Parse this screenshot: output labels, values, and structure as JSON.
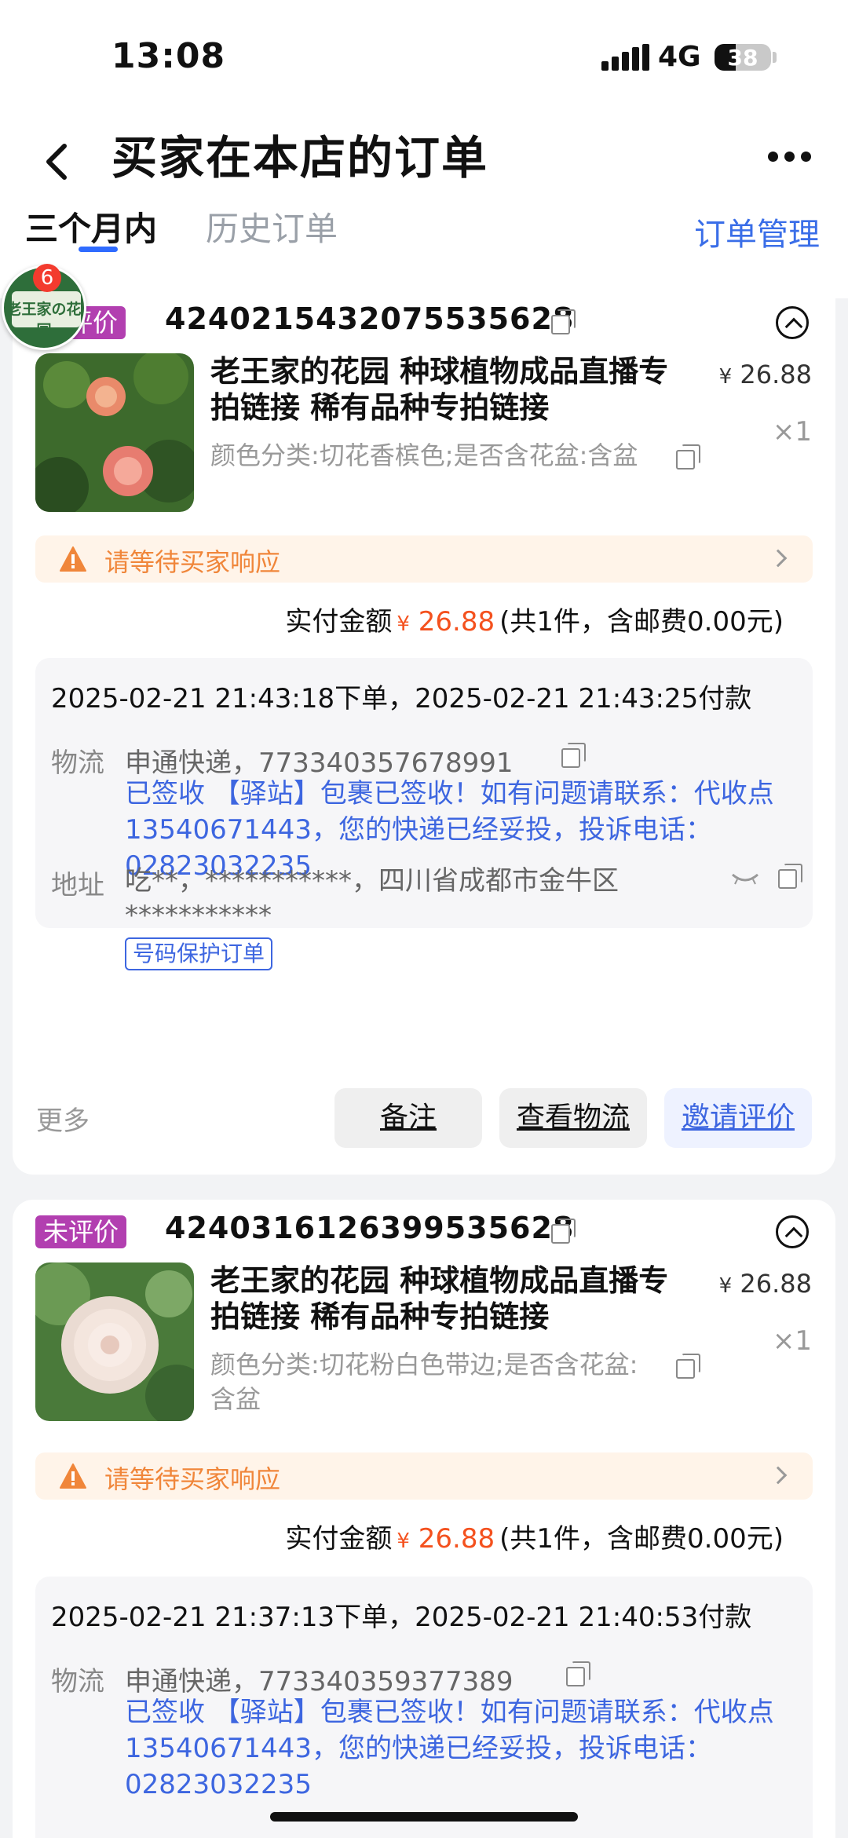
{
  "status_bar": {
    "time": "13:08",
    "network": "4G",
    "battery": "38"
  },
  "header": {
    "title": "买家在本店的订单",
    "tabs": [
      {
        "label": "三个月内",
        "active": true
      },
      {
        "label": "历史订单",
        "active": false
      }
    ],
    "order_management": "订单管理"
  },
  "shop_avatar": {
    "logo_text": "老王家の花园",
    "badge_count": "6"
  },
  "orders": [
    {
      "tag": "评价",
      "order_no": "4240215432075535628",
      "product_title": "老王家的花园 种球植物成品直播专拍链接 稀有品种专拍链接",
      "price": "26.88",
      "currency": "¥",
      "quantity": "×1",
      "spec": "颜色分类:切花香槟色;是否含花盆:含盆",
      "alert": "请等待买家响应",
      "pay_label": "实付金额",
      "pay_amount": "26.88",
      "pay_detail": "(共1件，含邮费0.00元)",
      "dates": "2025-02-21 21:43:18下单，2025-02-21 21:43:25付款",
      "logistics_label": "物流",
      "logistics": "申通快递，773340357678991",
      "tracking": "已签收 【驿站】包裹已签收！如有问题请联系：代收点13540671443，您的快递已经妥投，投诉电话：02823032235",
      "address_label": "地址",
      "address": "吃**，***********，四川省成都市金牛区***********",
      "protect_tag": "号码保护订单",
      "more": "更多",
      "buttons": {
        "note": "备注",
        "logistics": "查看物流",
        "invite": "邀请评价"
      }
    },
    {
      "tag": "未评价",
      "order_no": "4240316126399535628",
      "product_title": "老王家的花园 种球植物成品直播专拍链接 稀有品种专拍链接",
      "price": "26.88",
      "currency": "¥",
      "quantity": "×1",
      "spec": "颜色分类:切花粉白色带边;是否含花盆:含盆",
      "alert": "请等待买家响应",
      "pay_label": "实付金额",
      "pay_amount": "26.88",
      "pay_detail": "(共1件，含邮费0.00元)",
      "dates": "2025-02-21 21:37:13下单，2025-02-21 21:40:53付款",
      "logistics_label": "物流",
      "logistics": "申通快递，773340359377389",
      "tracking": "已签收 【驿站】包裹已签收！如有问题请联系：代收点13540671443，您的快递已经妥投，投诉电话：02823032235"
    }
  ]
}
